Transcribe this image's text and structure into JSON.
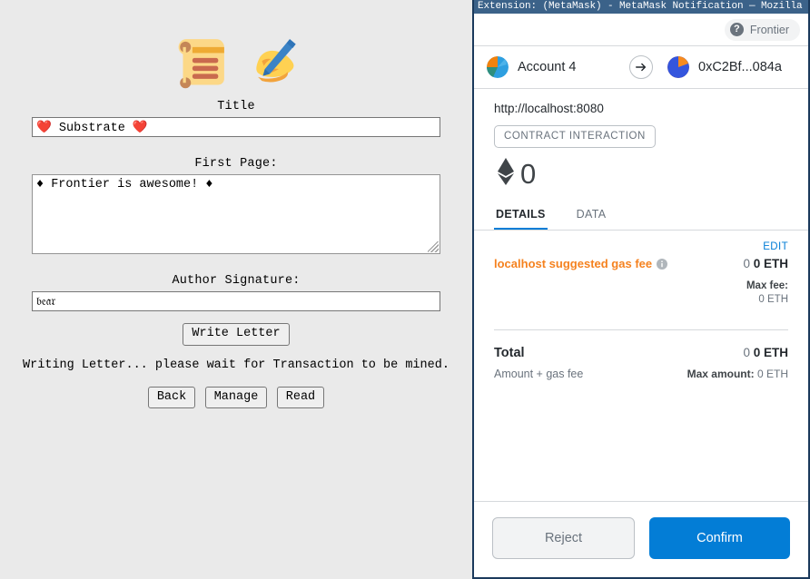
{
  "dapp": {
    "emoji": {
      "scroll": "scroll-emoji",
      "writing_hand": "writing-hand-emoji"
    },
    "title_label": "Title",
    "title_value": "❤️ Substrate ❤️",
    "first_page_label": "First Page:",
    "first_page_value": "♦ Frontier is awesome! ♦",
    "signature_label": "Author Signature:",
    "signature_value": "𝔟𝔢𝔞𝔯",
    "write_letter_button": "Write Letter",
    "status_text": "Writing Letter... please wait for Transaction to be mined.",
    "nav_buttons": [
      "Back",
      "Manage",
      "Read"
    ]
  },
  "metamask": {
    "window_title": "Extension: (MetaMask) - MetaMask Notification — Mozilla Fi…",
    "network": "Frontier",
    "from_account": "Account 4",
    "to_account": "0xC2Bf...084a",
    "origin_url": "http://localhost:8080",
    "transaction_type": "CONTRACT INTERACTION",
    "amount": "0",
    "tabs": [
      {
        "label": "DETAILS",
        "active": true
      },
      {
        "label": "DATA",
        "active": false
      }
    ],
    "details": {
      "edit_label": "EDIT",
      "gas_fee_label": "localhost suggested gas fee",
      "gas_fee_fiat": "0",
      "gas_fee_eth": "0 ETH",
      "max_fee_label": "Max fee:",
      "max_fee_value": "0 ETH",
      "total_label": "Total",
      "total_fiat": "0",
      "total_eth": "0 ETH",
      "total_sub": "Amount + gas fee",
      "max_amount_label": "Max amount:",
      "max_amount_value": "0 ETH"
    },
    "footer": {
      "reject_label": "Reject",
      "confirm_label": "Confirm"
    },
    "colors": {
      "accent_blue": "#037dd6",
      "gas_orange": "#f5821f",
      "titlebar": "#3b6289",
      "window_border": "#1b3a5c"
    }
  }
}
